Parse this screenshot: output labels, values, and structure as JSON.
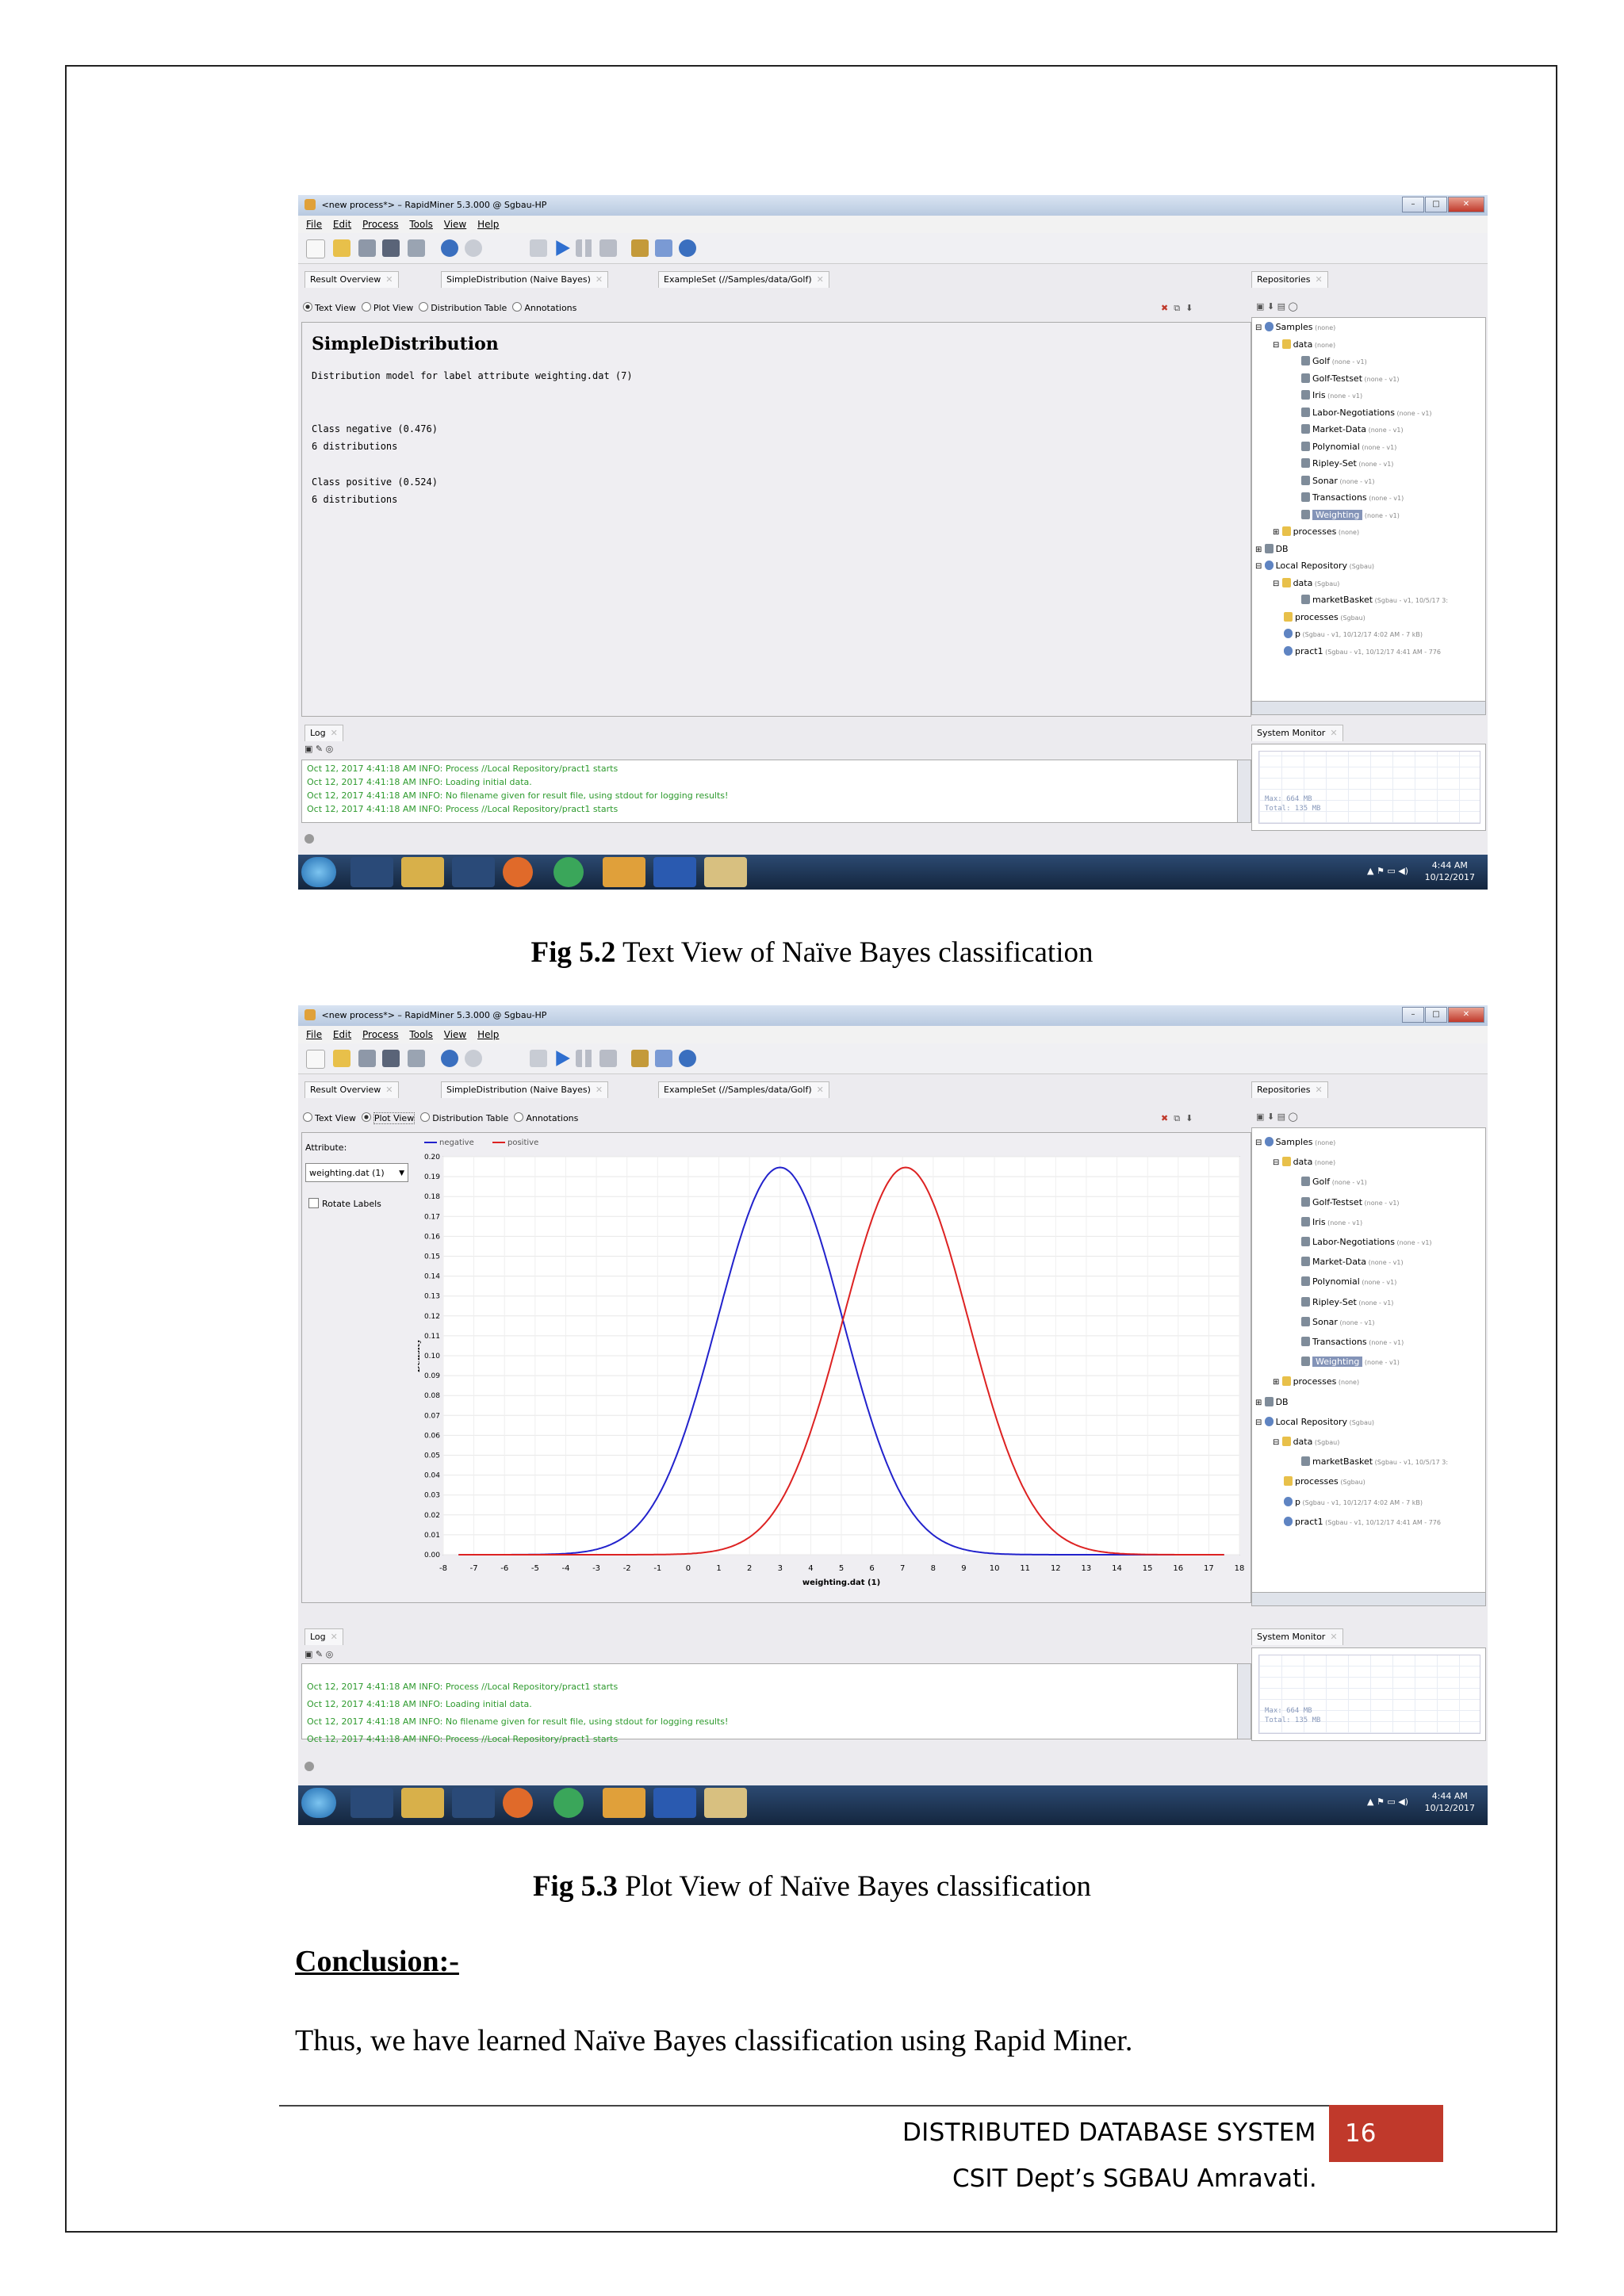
{
  "window": {
    "title": "<new process*> – RapidMiner 5.3.000 @ Sgbau-HP",
    "menu": [
      "File",
      "Edit",
      "Process",
      "Tools",
      "View",
      "Help"
    ]
  },
  "tabs": [
    "Result Overview",
    "SimpleDistribution (Naive Bayes)",
    "ExampleSet (//Samples/data/Golf)"
  ],
  "view_modes": [
    "Text View",
    "Plot View",
    "Distribution Table",
    "Annotations"
  ],
  "text_view": {
    "heading": "SimpleDistribution",
    "lines": [
      "Distribution model for label attribute weighting.dat (7)",
      "",
      "",
      "Class negative (0.476)",
      "6 distributions",
      "",
      "Class positive (0.524)",
      "6 distributions"
    ]
  },
  "repositories": {
    "title": "Repositories",
    "tree1": [
      {
        "label": "Samples",
        "meta": "(none)",
        "indent": 0,
        "icon": "repo",
        "exp": "⊟"
      },
      {
        "label": "data",
        "meta": "(none)",
        "indent": 1,
        "icon": "folder",
        "exp": "⊟"
      },
      {
        "label": "Golf",
        "meta": "(none - v1)",
        "indent": 2,
        "icon": "db"
      },
      {
        "label": "Golf-Testset",
        "meta": "(none - v1)",
        "indent": 2,
        "icon": "db"
      },
      {
        "label": "Iris",
        "meta": "(none - v1)",
        "indent": 2,
        "icon": "db"
      },
      {
        "label": "Labor-Negotiations",
        "meta": "(none - v1)",
        "indent": 2,
        "icon": "db"
      },
      {
        "label": "Market-Data",
        "meta": "(none - v1)",
        "indent": 2,
        "icon": "db"
      },
      {
        "label": "Polynomial",
        "meta": "(none - v1)",
        "indent": 2,
        "icon": "db"
      },
      {
        "label": "Ripley-Set",
        "meta": "(none - v1)",
        "indent": 2,
        "icon": "db"
      },
      {
        "label": "Sonar",
        "meta": "(none - v1)",
        "indent": 2,
        "icon": "db"
      },
      {
        "label": "Transactions",
        "meta": "(none - v1)",
        "indent": 2,
        "icon": "db"
      },
      {
        "label": "Weighting",
        "meta": "(none - v1)",
        "indent": 2,
        "icon": "db",
        "sel": true
      },
      {
        "label": "processes",
        "meta": "(none)",
        "indent": 1,
        "icon": "folder",
        "exp": "⊞"
      },
      {
        "label": "DB",
        "meta": "",
        "indent": 0,
        "icon": "db",
        "exp": "⊞"
      },
      {
        "label": "Local Repository",
        "meta": "(Sgbau)",
        "indent": 0,
        "icon": "repo",
        "exp": "⊟"
      },
      {
        "label": "data",
        "meta": "(Sgbau)",
        "indent": 1,
        "icon": "folder",
        "exp": "⊟"
      },
      {
        "label": "marketBasket",
        "meta": "(Sgbau - v1, 10/5/17 3:",
        "indent": 2,
        "icon": "db"
      },
      {
        "label": "processes",
        "meta": "(Sgbau)",
        "indent": 1,
        "icon": "folder"
      },
      {
        "label": "p",
        "meta": "(Sgbau - v1, 10/12/17 4:02 AM - 7 kB)",
        "indent": 1,
        "icon": "repo"
      },
      {
        "label": "pract1",
        "meta": "(Sgbau - v1, 10/12/17 4:41 AM - 776",
        "indent": 1,
        "icon": "repo"
      }
    ]
  },
  "log": {
    "title": "Log",
    "lines": [
      "Oct 12, 2017 4:41:18 AM INFO: Process //Local Repository/pract1 starts",
      "Oct 12, 2017 4:41:18 AM INFO: Loading initial data.",
      "Oct 12, 2017 4:41:18 AM INFO: No filename given for result file, using stdout for logging results!",
      "Oct 12, 2017 4:41:18 AM INFO: Process //Local Repository/pract1 starts"
    ]
  },
  "system_monitor": {
    "title": "System Monitor",
    "max": "Max:   664 MB",
    "total": "Total: 135 MB"
  },
  "taskbar": {
    "time": "4:44 AM",
    "date": "10/12/2017",
    "tray": "▲ ⚑ ▭ ◀)"
  },
  "plot_view": {
    "attribute_label": "Attribute:",
    "attribute_value": "weighting.dat (1)",
    "rotate_labels": "Rotate Labels"
  },
  "chart_data": {
    "type": "line",
    "xlabel": "weighting.dat (1)",
    "ylabel": "Density",
    "xlim": [
      -8,
      18
    ],
    "ylim": [
      0,
      0.2
    ],
    "xticks": [
      -8,
      -7,
      -6,
      -5,
      -4,
      -3,
      -2,
      -1,
      0,
      1,
      2,
      3,
      4,
      5,
      6,
      7,
      8,
      9,
      10,
      11,
      12,
      13,
      14,
      15,
      16,
      17,
      18
    ],
    "yticks": [
      "0.00",
      "0.01",
      "0.02",
      "0.03",
      "0.04",
      "0.05",
      "0.06",
      "0.07",
      "0.08",
      "0.09",
      "0.10",
      "0.11",
      "0.12",
      "0.13",
      "0.14",
      "0.15",
      "0.16",
      "0.17",
      "0.18",
      "0.19",
      "0.20"
    ],
    "x_range": [
      -7.5,
      17.5
    ],
    "series": [
      {
        "name": "negative",
        "color": "#2222cc",
        "mean": 3.0,
        "std": 2.05
      },
      {
        "name": "positive",
        "color": "#dd2222",
        "mean": 7.1,
        "std": 2.05
      }
    ]
  },
  "captions": {
    "fig1_label": "Fig 5.2",
    "fig1_text": " Text View of Naïve Bayes classification",
    "fig2_label": "Fig 5.3",
    "fig2_text": " Plot View of Naïve Bayes classification"
  },
  "conclusion": {
    "heading": "Conclusion:-",
    "text": "Thus, we have learned Naïve Bayes classification using Rapid Miner."
  },
  "footer": {
    "course": "DISTRIBUTED  DATABASE SYSTEM",
    "page": "16",
    "dept": "CSIT Dept’s SGBAU Amravati."
  }
}
